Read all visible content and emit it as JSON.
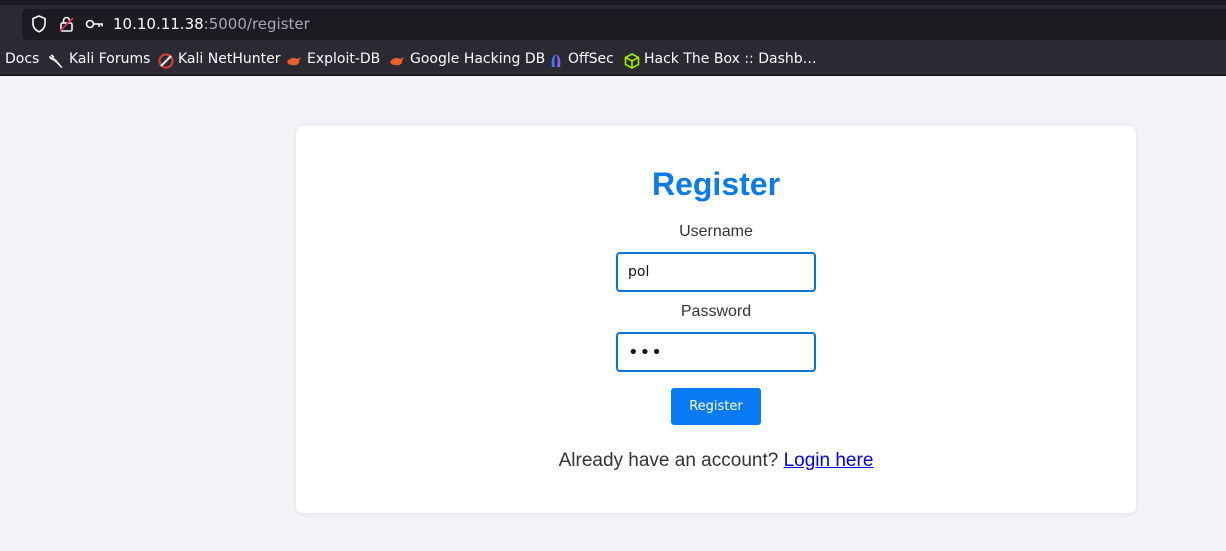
{
  "browser": {
    "url_host": "10.10.11.38",
    "url_path": ":5000/register",
    "bookmarks": [
      {
        "label": "Docs",
        "icon": "none"
      },
      {
        "label": "Kali Forums",
        "icon": "kali-dragon-icon"
      },
      {
        "label": "Kali NetHunter",
        "icon": "nethunter-icon"
      },
      {
        "label": "Exploit-DB",
        "icon": "exploit-db-icon"
      },
      {
        "label": "Google Hacking DB",
        "icon": "ghdb-icon"
      },
      {
        "label": "OffSec",
        "icon": "offsec-icon"
      },
      {
        "label": "Hack The Box :: Dashb…",
        "icon": "htb-cube-icon"
      }
    ]
  },
  "page": {
    "title": "Register",
    "username_label": "Username",
    "username_value": "pol",
    "password_label": "Password",
    "password_value": "•••",
    "submit_label": "Register",
    "footer_text": "Already have an account? ",
    "login_link": "Login here"
  },
  "colors": {
    "accent": "#0a7be8",
    "button": "#0a7bf5",
    "link": "#0000ee",
    "background": "#f4f4f8"
  }
}
